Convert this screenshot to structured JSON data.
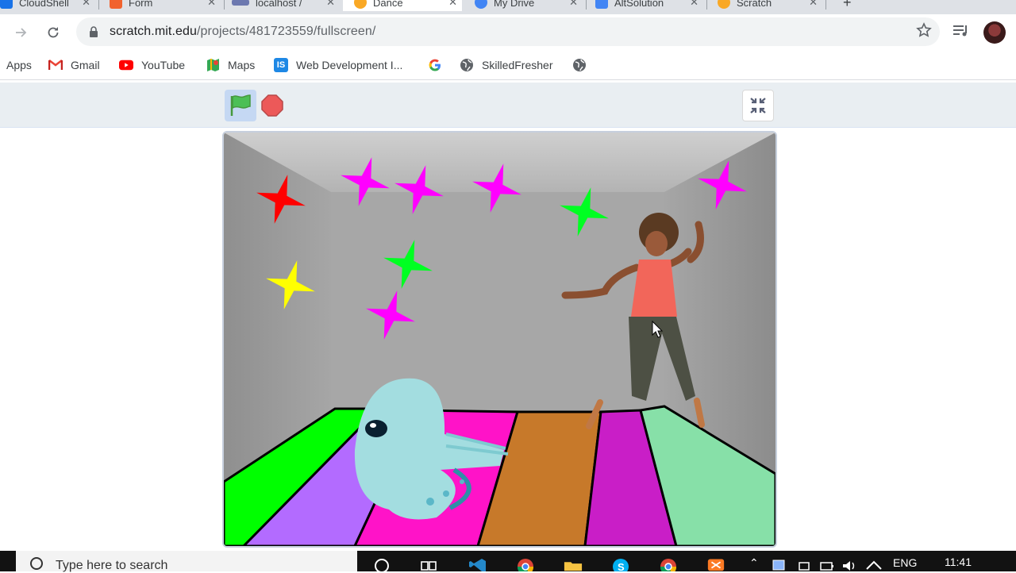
{
  "browser": {
    "tabs": [
      {
        "title": "CloudShell",
        "active": false
      },
      {
        "title": "Form",
        "active": false
      },
      {
        "title": "localhost / ",
        "active": false
      },
      {
        "title": "Dance",
        "active": true
      },
      {
        "title": "My Drive",
        "active": false
      },
      {
        "title": "AltSolution",
        "active": false
      },
      {
        "title": "Scratch",
        "active": false
      }
    ],
    "new_tab_label": "+",
    "address": {
      "host": "scratch.mit.edu",
      "path": "/projects/481723559/fullscreen/"
    },
    "bookmarks": [
      {
        "label": "Apps",
        "icon": "apps-grid-icon"
      },
      {
        "label": "Gmail",
        "icon": "gmail-icon"
      },
      {
        "label": "YouTube",
        "icon": "youtube-icon"
      },
      {
        "label": "Maps",
        "icon": "maps-icon"
      },
      {
        "label": "Web Development I...",
        "icon": "web-dev-icon"
      },
      {
        "label": "",
        "icon": "google-icon"
      },
      {
        "label": "SkilledFresher",
        "icon": "globe-icon"
      },
      {
        "label": "",
        "icon": "globe-icon"
      }
    ]
  },
  "player": {
    "green_flag_color": "#4cbf56",
    "stop_color": "#ec5959",
    "stage_sprites": [
      "dancer-sprite",
      "ghost-sprite",
      "star-sprites"
    ]
  },
  "taskbar": {
    "search_placeholder": "Type here to search",
    "language": "ENG",
    "time": "11:41"
  },
  "colors": {
    "accent": "#4c97ff",
    "chrome_tabstrip": "#dee1e6"
  }
}
